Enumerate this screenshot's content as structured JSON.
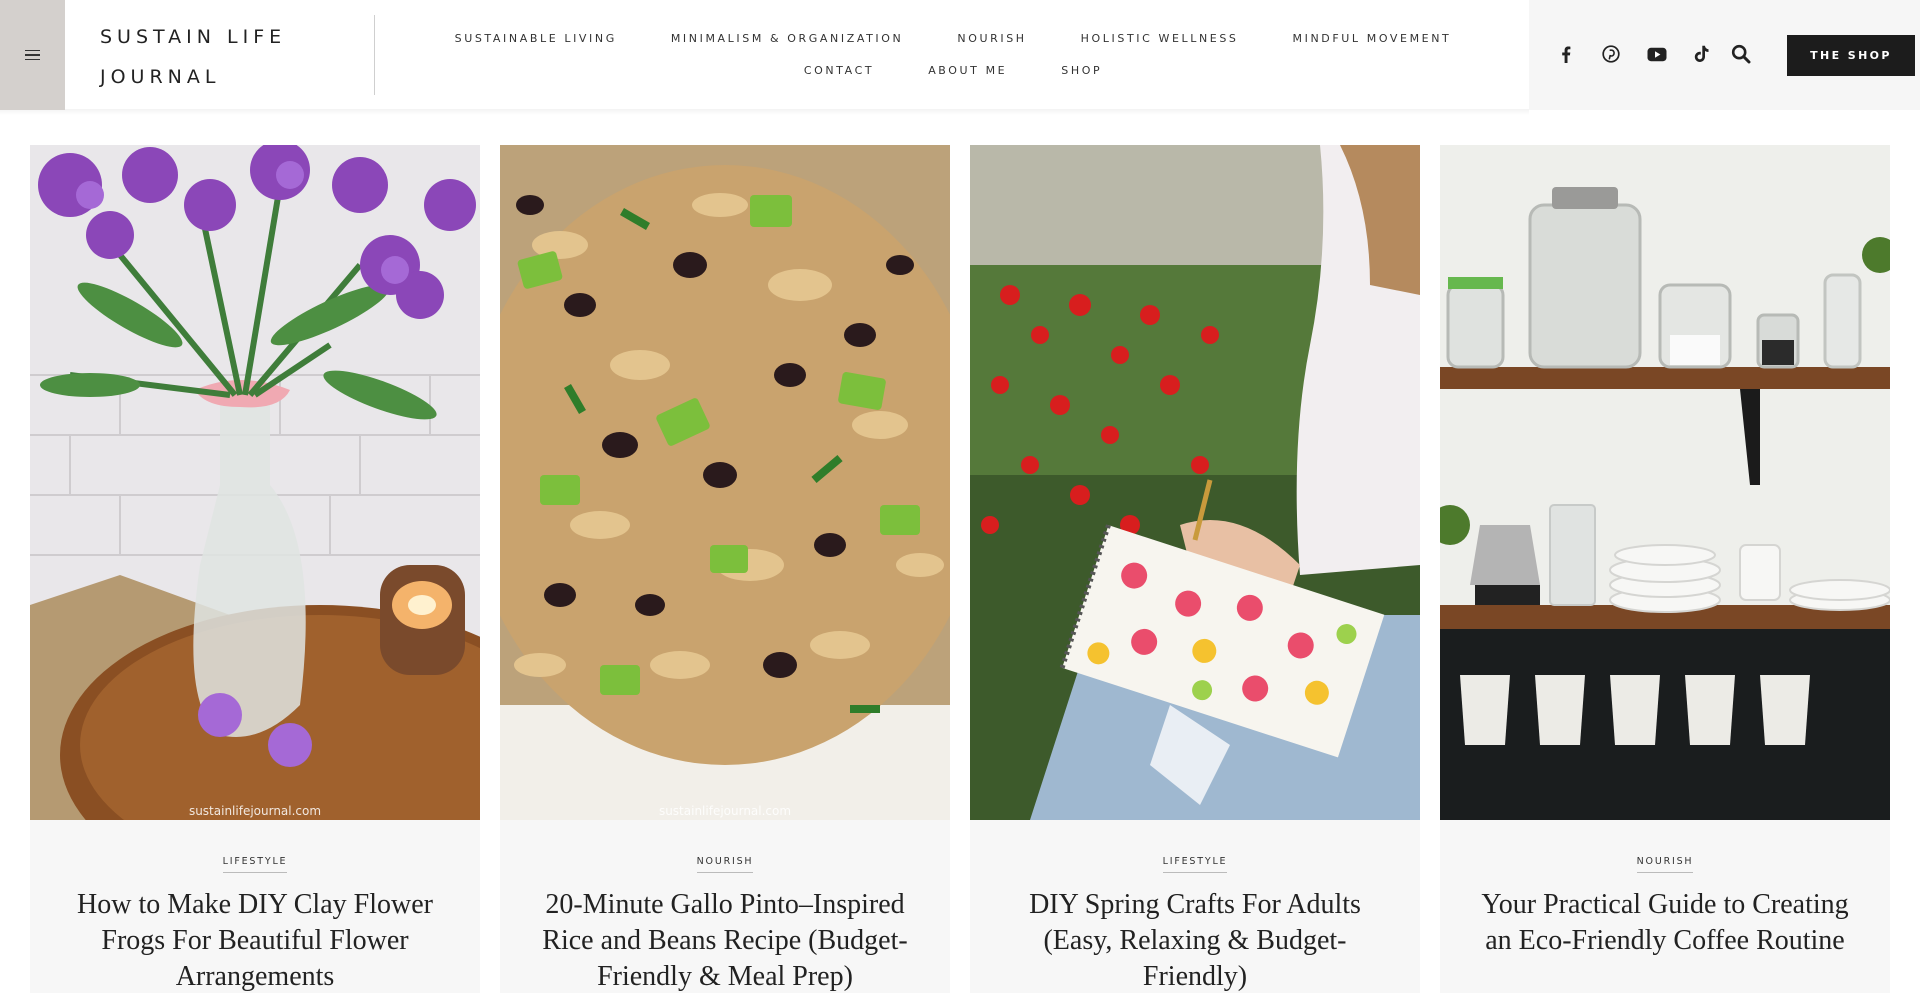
{
  "site": {
    "logo_line1": "SUSTAIN LIFE",
    "logo_line2": "JOURNAL"
  },
  "nav": {
    "row1": [
      "SUSTAINABLE LIVING",
      "MINIMALISM & ORGANIZATION",
      "NOURISH",
      "HOLISTIC WELLNESS",
      "MINDFUL MOVEMENT"
    ],
    "row2": [
      "CONTACT",
      "ABOUT ME",
      "SHOP"
    ]
  },
  "social_icons": [
    "facebook-icon",
    "pinterest-icon",
    "youtube-icon",
    "tiktok-icon",
    "search-icon"
  ],
  "shop_button": "THE SHOP",
  "colors": {
    "menu_toggle_bg": "#d4d0cd",
    "shop_button_bg": "#1c1c1c",
    "card_bg": "#f7f7f7"
  },
  "posts": [
    {
      "category": "LIFESTYLE",
      "title": "How to Make DIY Clay Flower Frogs For Beautiful Flower Arrangements",
      "watermark": "sustainlifejournal.com"
    },
    {
      "category": "NOURISH",
      "title": "20-Minute Gallo Pinto–Inspired Rice and Beans Recipe (Budget-Friendly & Meal Prep)",
      "watermark": "sustainlifejournal.com"
    },
    {
      "category": "LIFESTYLE",
      "title": "DIY Spring Crafts For Adults (Easy, Relaxing & Budget-Friendly)"
    },
    {
      "category": "NOURISH",
      "title": "Your Practical Guide to Creating an Eco-Friendly Coffee Routine"
    }
  ]
}
